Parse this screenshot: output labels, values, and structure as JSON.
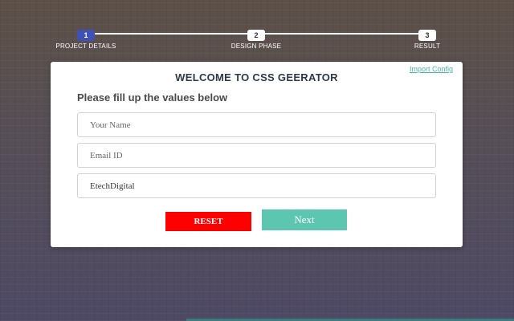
{
  "progress": {
    "steps": [
      {
        "number": "1",
        "label": "PROJECT DETAILS",
        "active": true
      },
      {
        "number": "2",
        "label": "DESIGN PHASE",
        "active": false
      },
      {
        "number": "3",
        "label": "RESULT",
        "active": false
      }
    ]
  },
  "card": {
    "title": "WELCOME TO CSS GEERATOR",
    "import_link": "Import Config",
    "subtitle": "Please fill up the values below",
    "fields": {
      "name": {
        "placeholder": "Your Name",
        "value": ""
      },
      "email": {
        "placeholder": "Email ID",
        "value": ""
      },
      "company": {
        "placeholder": "",
        "value": "EtechDigital"
      }
    },
    "buttons": {
      "reset": "RESET",
      "next": "Next"
    }
  },
  "colors": {
    "active_step": "#3f51b5",
    "reset_button": "#ff0000",
    "next_button": "#5cc6b0",
    "link": "#48b8a0"
  }
}
